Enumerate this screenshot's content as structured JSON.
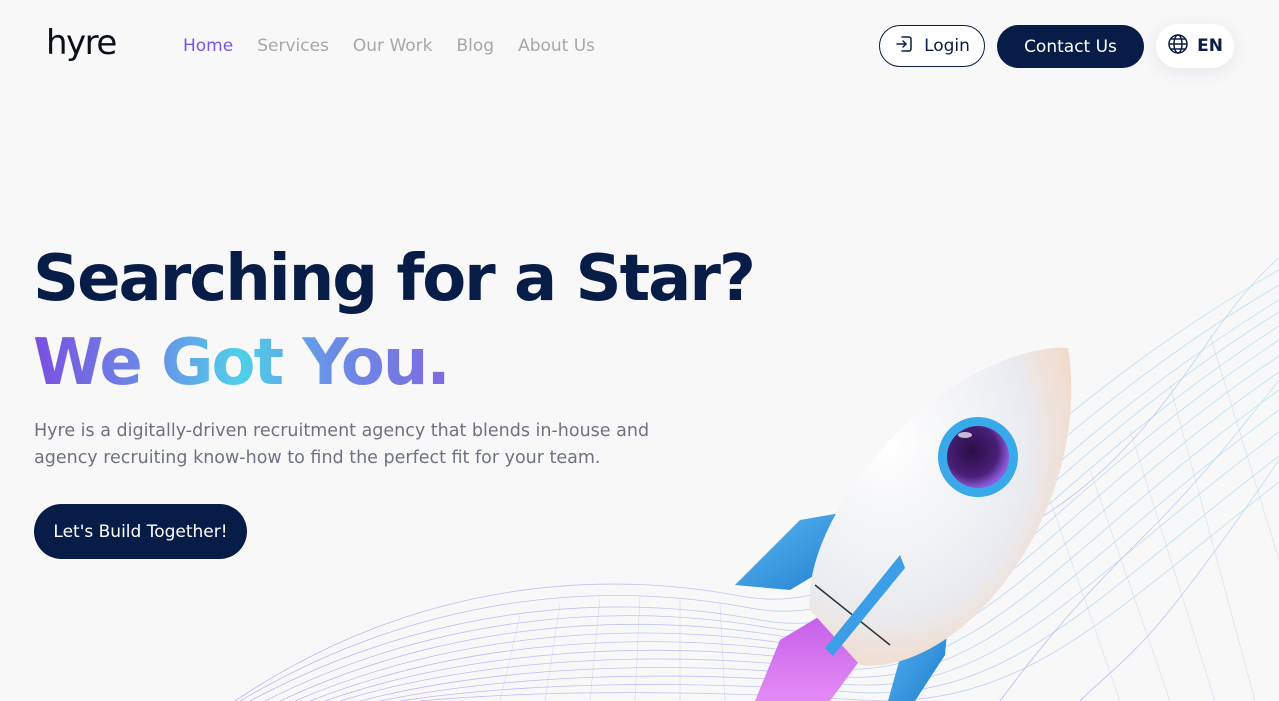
{
  "header": {
    "logo": "hyre",
    "nav": [
      {
        "label": "Home",
        "active": true
      },
      {
        "label": "Services",
        "active": false
      },
      {
        "label": "Our Work",
        "active": false
      },
      {
        "label": "Blog",
        "active": false
      },
      {
        "label": "About Us",
        "active": false
      }
    ],
    "login_label": "Login",
    "contact_label": "Contact Us",
    "lang_label": "EN"
  },
  "hero": {
    "headline_line1": "Searching for a Star?",
    "headline_line2": "We Got You.",
    "description": "Hyre is a digitally-driven recruitment agency that blends in-house and agency recruiting know-how to find the perfect fit for your team.",
    "cta_label": "Let's Build Together!"
  },
  "icons": {
    "login": "login-icon",
    "language": "globe-icon",
    "illustration": "rocket-illustration"
  },
  "colors": {
    "navy": "#071c47",
    "nav_active": "#7b55e4",
    "nav_inactive": "#a5a7ad",
    "background": "#f8f8f9"
  }
}
